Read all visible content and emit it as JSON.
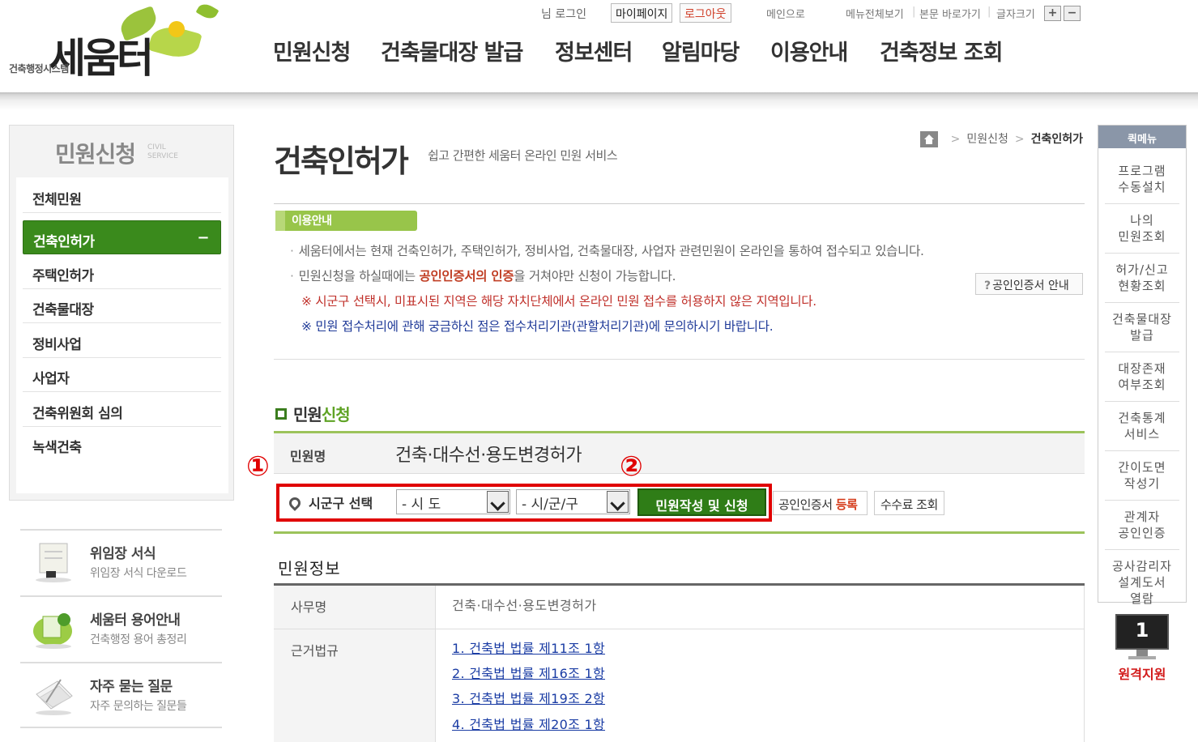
{
  "header": {
    "logo_sub": "건축행정시스템",
    "logo_main": "세움터",
    "util": {
      "login_status": "님 로그인",
      "mypage": "마이페이지",
      "logout": "로그아웃",
      "main": "메인으로",
      "sitemap": "메뉴전체보기",
      "skip": "본문 바로가기",
      "fontsize": "글자크기",
      "plus": "+",
      "minus": "−"
    },
    "gnb": [
      "민원신청",
      "건축물대장 발급",
      "정보센터",
      "알림마당",
      "이용안내",
      "건축정보 조회"
    ]
  },
  "sidebar": {
    "title": "민원신청",
    "title_en": [
      "CIVIL",
      "SERVICE"
    ],
    "items": [
      {
        "label": "전체민원"
      },
      {
        "label": "건축인허가",
        "active": true
      },
      {
        "label": "주택인허가"
      },
      {
        "label": "건축물대장"
      },
      {
        "label": "정비사업"
      },
      {
        "label": "사업자"
      },
      {
        "label": "건축위원회 심의"
      },
      {
        "label": "녹색건축"
      }
    ],
    "active_marker": "−",
    "banners": [
      {
        "title": "위임장 서식",
        "desc": "위임장 서식 다운로드",
        "icon": "document-stamp-icon"
      },
      {
        "title": "세움터 용어안내",
        "desc": "건축행정 용어 총정리",
        "icon": "glossary-icon"
      },
      {
        "title": "자주 묻는 질문",
        "desc": "자주 문의하는 질문들",
        "icon": "faq-icon"
      }
    ]
  },
  "main": {
    "title": "건축인허가",
    "subtitle": "쉽고 간편한 세움터 온라인 민원 서비스",
    "breadcrumb": [
      "민원신청",
      "건축인허가"
    ],
    "guide": {
      "tab": "이용안내",
      "line1": "세움터에서는 현재 건축인허가, 주택인허가, 정비사업, 건축물대장, 사업자 관련민원이 온라인을 통하여 접수되고 있습니다.",
      "line2_pre": "민원신청을 하실때에는 ",
      "line2_bold": "공인인증서의 인증",
      "line2_post": "을 거쳐야만 신청이 가능합니다.",
      "line3": "※ 시군구 선택시, 미표시된 지역은 해당 자치단체에서 온라인 민원 접수를 허용하지 않은 지역입니다.",
      "line4": "※ 민원 접수처리에 관해 궁금하신 점은 접수처리기관(관할처리기관)에 문의하시기 바랍니다.",
      "cert_guide_btn": "공인인증서 안내",
      "cert_guide_q": "?"
    },
    "apply": {
      "heading_a": "민원",
      "heading_b": "신청",
      "name_label": "민원명",
      "name_value": "건축·대수선·용도변경허가",
      "region_label": "시군구 선택",
      "sido": "- 시 도",
      "sigungu": "- 시/군/구",
      "apply_btn": "민원작성 및 신청",
      "cert_reg_a": "공인인증서 ",
      "cert_reg_b": "등록",
      "fee_btn": "수수료 조회",
      "marker1": "①",
      "marker2": "②"
    },
    "info": {
      "heading": "민원정보",
      "office_label": "사무명",
      "office_value": "건축·대수선·용도변경허가",
      "law_label": "근거법규",
      "laws": [
        "1. 건축법 법률 제11조 1항",
        "2. 건축법 법률 제16조 1항",
        "3. 건축법 법률 제19조 2항",
        "4. 건축법 법률 제20조 1항"
      ]
    }
  },
  "quick": {
    "title": "퀵메뉴",
    "items": [
      [
        "프로그램",
        "수동설치"
      ],
      [
        "나의",
        "민원조회"
      ],
      [
        "허가/신고",
        "현황조회"
      ],
      [
        "건축물대장",
        "발급"
      ],
      [
        "대장존재",
        "여부조회"
      ],
      [
        "건축통계",
        "서비스"
      ],
      [
        "간이도면",
        "작성기"
      ],
      [
        "관계자",
        "공인인증"
      ],
      [
        "공사감리자",
        "설계도서",
        "열람"
      ]
    ],
    "remote_number": "1",
    "remote_label": "원격지원"
  }
}
